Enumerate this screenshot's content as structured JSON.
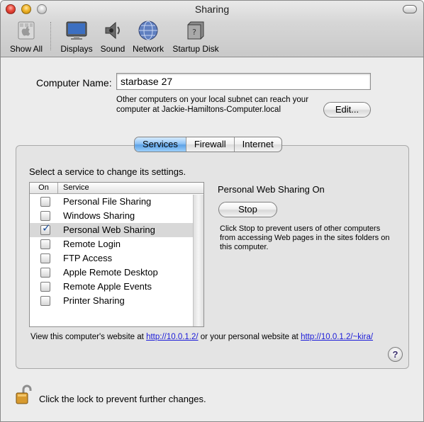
{
  "window": {
    "title": "Sharing"
  },
  "toolbar": {
    "items": [
      {
        "label": "Show All",
        "icon": "apple-grid-icon"
      },
      {
        "label": "Displays",
        "icon": "display-icon"
      },
      {
        "label": "Sound",
        "icon": "speaker-icon"
      },
      {
        "label": "Network",
        "icon": "globe-icon"
      },
      {
        "label": "Startup Disk",
        "icon": "hard-disk-icon"
      }
    ]
  },
  "computer_name": {
    "label": "Computer Name:",
    "value": "starbase 27",
    "note": "Other computers on your local subnet can reach your computer at Jackie-Hamiltons-Computer.local",
    "edit_button": "Edit..."
  },
  "tabs": [
    {
      "label": "Services",
      "selected": true
    },
    {
      "label": "Firewall",
      "selected": false
    },
    {
      "label": "Internet",
      "selected": false
    }
  ],
  "services": {
    "prompt": "Select a service to change its settings.",
    "columns": {
      "on": "On",
      "service": "Service"
    },
    "items": [
      {
        "name": "Personal File Sharing",
        "on": false,
        "selected": false
      },
      {
        "name": "Windows Sharing",
        "on": false,
        "selected": false
      },
      {
        "name": "Personal Web Sharing",
        "on": true,
        "selected": true
      },
      {
        "name": "Remote Login",
        "on": false,
        "selected": false
      },
      {
        "name": "FTP Access",
        "on": false,
        "selected": false
      },
      {
        "name": "Apple Remote Desktop",
        "on": false,
        "selected": false
      },
      {
        "name": "Remote Apple Events",
        "on": false,
        "selected": false
      },
      {
        "name": "Printer Sharing",
        "on": false,
        "selected": false
      }
    ],
    "status": "Personal Web Sharing On",
    "stop_button": "Stop",
    "description": "Click Stop to prevent users of other computers from accessing Web pages in the sites folders on this computer."
  },
  "website_note": {
    "prefix": "View this computer's website at ",
    "link1": "http://10.0.1.2/",
    "middle": " or your personal website at ",
    "link2": "http://10.0.1.2/~kira/"
  },
  "help_button": "?",
  "lock": {
    "text": "Click the lock to prevent further changes.",
    "icon": "lock-icon"
  },
  "colors": {
    "tab_selected": "#6aaef0",
    "checkmark": "#1d4f9a",
    "link": "#1a1ad8",
    "window_bg": "#ececec"
  }
}
